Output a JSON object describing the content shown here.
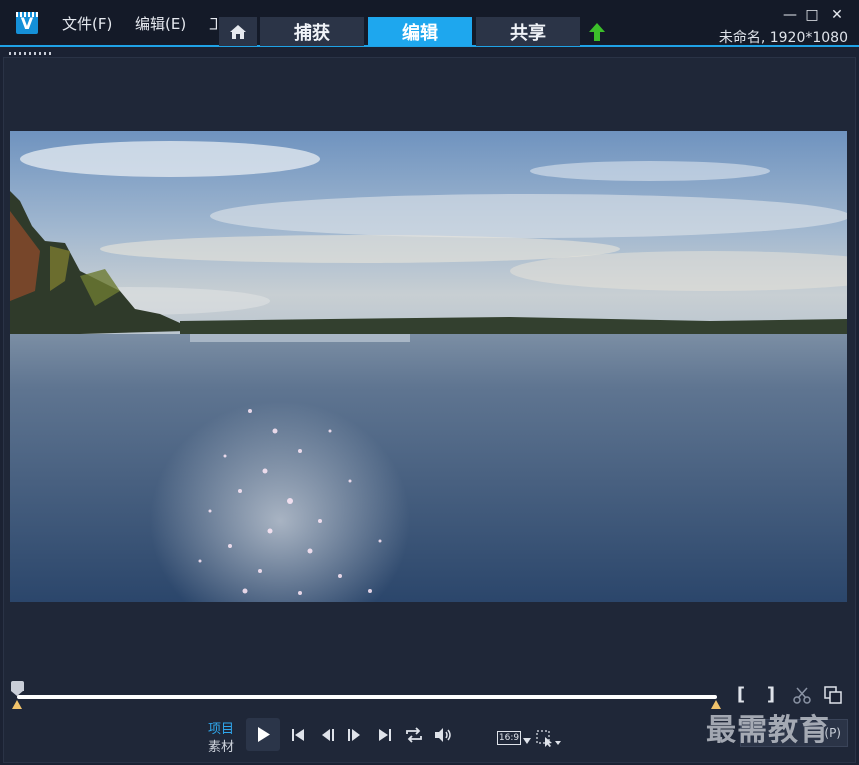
{
  "app": {
    "logo_letter": "V",
    "menus": [
      "文件(F)",
      "编辑(E)",
      "工"
    ],
    "tabs": [
      {
        "label": "捕获",
        "active": false
      },
      {
        "label": "编辑",
        "active": true
      },
      {
        "label": "共享",
        "active": false
      }
    ],
    "project_info": "未命名, 1920*1080",
    "window_controls": {
      "minimize": "—",
      "maximize": "□",
      "close": "✕"
    }
  },
  "player": {
    "mode_labels": [
      "项目",
      "素材"
    ],
    "aspect_ratio": "16:9",
    "right_button_label": "(P)",
    "mark_in_icon": "[",
    "mark_out_icon": "]"
  },
  "colors": {
    "accent": "#1fa2e6",
    "active_tab": "#1ea7ee",
    "background": "#1b2233",
    "upload_arrow": "#3cbf2a",
    "marker": "#f1c36b"
  },
  "watermark": "最需教育"
}
